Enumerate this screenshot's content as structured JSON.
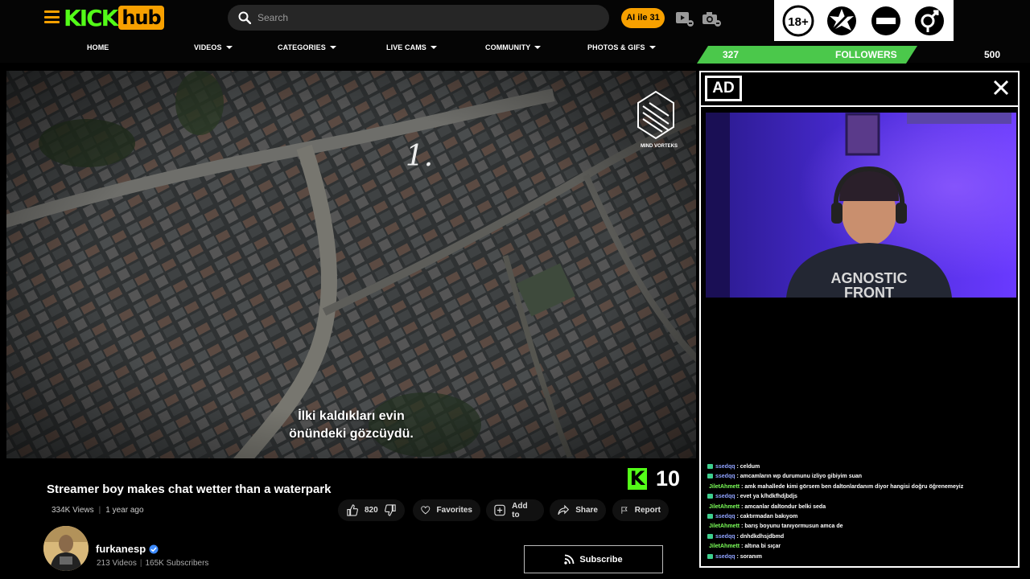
{
  "header": {
    "logo_left": "KICK",
    "logo_right": "hub",
    "search_placeholder": "Search",
    "ai_button": "AI ile 31"
  },
  "nav": [
    {
      "label": "HOME"
    },
    {
      "label": "VIDEOS"
    },
    {
      "label": "CATEGORIES"
    },
    {
      "label": "LIVE CAMS"
    },
    {
      "label": "COMMUNITY"
    },
    {
      "label": "PHOTOS & GIFS"
    }
  ],
  "badges": [
    "18+",
    "censor-star",
    "minus",
    "gender"
  ],
  "followers": {
    "current": "327",
    "label": "FOLLOWERS",
    "goal": "500",
    "progress": 0.654
  },
  "video": {
    "overlay_number": "1.",
    "watermark": "MIND VORTEKS",
    "subtitle_line1": "İlki kaldıkları evin",
    "subtitle_line2": "önündeki gözcüydü.",
    "title": "Streamer boy makes chat wetter than a waterpark",
    "views": "334K Views",
    "age": "1 year ago",
    "score_letter": "K",
    "score": "10"
  },
  "actions": {
    "likes": "820",
    "favorites": "Favorites",
    "add_to": "Add to",
    "share": "Share",
    "report": "Report"
  },
  "channel": {
    "name": "furkanesp",
    "videos": "213 Videos",
    "subscribers": "165K Subscribers",
    "subscribe": "Subscribe"
  },
  "ad": {
    "label": "AD",
    "shirt_line1": "AGNOSTIC",
    "shirt_line2": "FRONT",
    "chat": [
      {
        "user": "ssedqq",
        "msg": " : celdum",
        "style": "u1"
      },
      {
        "user": "ssedqq",
        "msg": " : amcamların wp durumunu izliyo gibiyim suan",
        "style": "u1"
      },
      {
        "user": "JiletAhmett",
        "msg": " : amk mahallede kimi görsem ben daltonlardanım diyor hangisi doğru öğrenemeyiz",
        "style": "u2"
      },
      {
        "user": "ssedqq",
        "msg": " : evet ya k/hdkfhdjbdjs",
        "style": "u1"
      },
      {
        "user": "JiletAhmett",
        "msg": " : amcanlar daltondur belki seda",
        "style": "u2"
      },
      {
        "user": "ssedqq",
        "msg": " : caktırmadan bakıyom",
        "style": "u1"
      },
      {
        "user": "JiletAhmett",
        "msg": " : barış boyunu tanıyormusun amca de",
        "style": "u2"
      },
      {
        "user": "ssedqq",
        "msg": " : dnhdkdhsjdbmd",
        "style": "u1"
      },
      {
        "user": "JiletAhmett",
        "msg": " : altına bi sıçar",
        "style": "u2"
      },
      {
        "user": "ssedqq",
        "msg": " : soranım",
        "style": "u1"
      }
    ]
  }
}
